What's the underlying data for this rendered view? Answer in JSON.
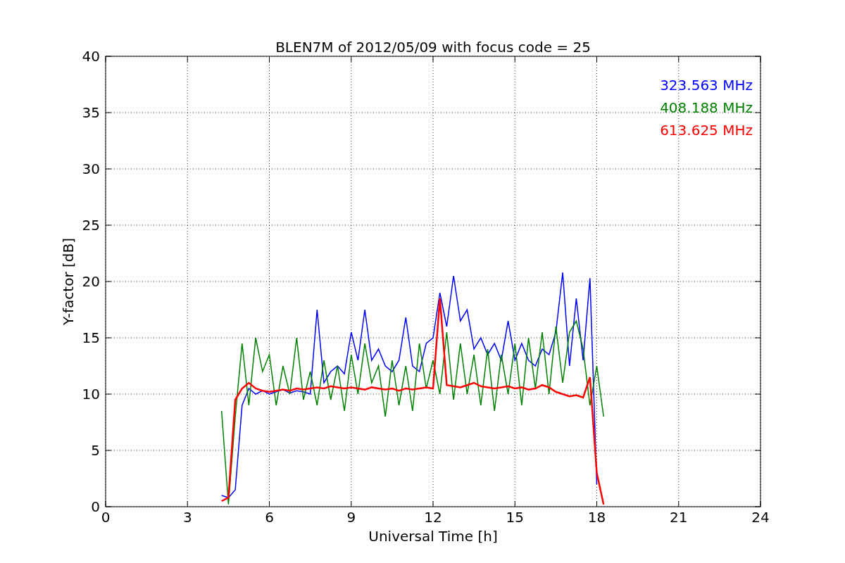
{
  "chart_data": {
    "type": "line",
    "title": "BLEN7M of 2012/05/09 with focus code = 25",
    "xlabel": "Universal Time [h]",
    "ylabel": "Y-factor [dB]",
    "x": [
      4.25,
      4.5,
      4.75,
      5.0,
      5.25,
      5.5,
      5.75,
      6.0,
      6.25,
      6.5,
      6.75,
      7.0,
      7.25,
      7.5,
      7.75,
      8.0,
      8.25,
      8.5,
      8.75,
      9.0,
      9.25,
      9.5,
      9.75,
      10.0,
      10.25,
      10.5,
      10.75,
      11.0,
      11.25,
      11.5,
      11.75,
      12.0,
      12.25,
      12.5,
      12.75,
      13.0,
      13.25,
      13.5,
      13.75,
      14.0,
      14.25,
      14.5,
      14.75,
      15.0,
      15.25,
      15.5,
      15.75,
      16.0,
      16.25,
      16.5,
      16.75,
      17.0,
      17.25,
      17.5,
      17.75,
      18.0,
      18.25
    ],
    "series": [
      {
        "name": "323.563 MHz",
        "color": "#0000ff",
        "values": [
          1,
          0.8,
          1.5,
          9,
          10.5,
          10,
          10.3,
          10,
          10.2,
          10.4,
          10.1,
          10.3,
          10.2,
          10,
          17.5,
          11,
          12,
          12.5,
          11.8,
          15.5,
          13,
          17.5,
          13,
          14,
          12.5,
          12,
          13,
          16.8,
          12.5,
          12,
          14.5,
          15,
          19,
          16,
          20.5,
          16.5,
          17.5,
          14,
          15,
          13.5,
          14.5,
          13,
          16.5,
          13,
          14.5,
          13,
          12.5,
          14,
          13.5,
          15.5,
          20.8,
          12.5,
          18.5,
          13,
          20.3,
          2,
          null
        ]
      },
      {
        "name": "408.188 MHz",
        "color": "#008000",
        "values": [
          8.5,
          0.2,
          8,
          14.5,
          9,
          15,
          12,
          13.5,
          9,
          12.5,
          10,
          15,
          9.5,
          12,
          9,
          13,
          9.5,
          12.5,
          8.5,
          13.5,
          10,
          14.5,
          11,
          12.5,
          8,
          13,
          9,
          12.5,
          8.5,
          14.5,
          10.5,
          13,
          10,
          15.5,
          9.5,
          14.5,
          10,
          13.5,
          9,
          14,
          8.5,
          13.5,
          10,
          14.5,
          9,
          15,
          10.5,
          15.5,
          10,
          16,
          11,
          15.5,
          16.5,
          14,
          9,
          12.5,
          8
        ]
      },
      {
        "name": "613.625 MHz",
        "color": "#ff0000",
        "values": [
          0.5,
          0.8,
          9.5,
          10.5,
          11,
          10.5,
          10.3,
          10.2,
          10.3,
          10.4,
          10.3,
          10.5,
          10.4,
          10.5,
          10.6,
          10.5,
          10.7,
          10.6,
          10.5,
          10.6,
          10.5,
          10.4,
          10.6,
          10.5,
          10.4,
          10.5,
          10.3,
          10.5,
          10.4,
          10.5,
          10.6,
          10.5,
          18.5,
          10.8,
          10.7,
          10.6,
          10.8,
          11,
          10.7,
          10.6,
          10.5,
          10.6,
          10.7,
          10.5,
          10.6,
          10.4,
          10.5,
          10.8,
          10.6,
          10.2,
          10,
          9.8,
          9.9,
          9.7,
          11.5,
          3,
          0.2
        ]
      }
    ],
    "xlim": [
      0,
      24
    ],
    "ylim": [
      0,
      40
    ],
    "xticks": [
      0,
      3,
      6,
      9,
      12,
      15,
      18,
      21,
      24
    ],
    "yticks": [
      0,
      5,
      10,
      15,
      20,
      25,
      30,
      35,
      40
    ],
    "grid": true
  }
}
